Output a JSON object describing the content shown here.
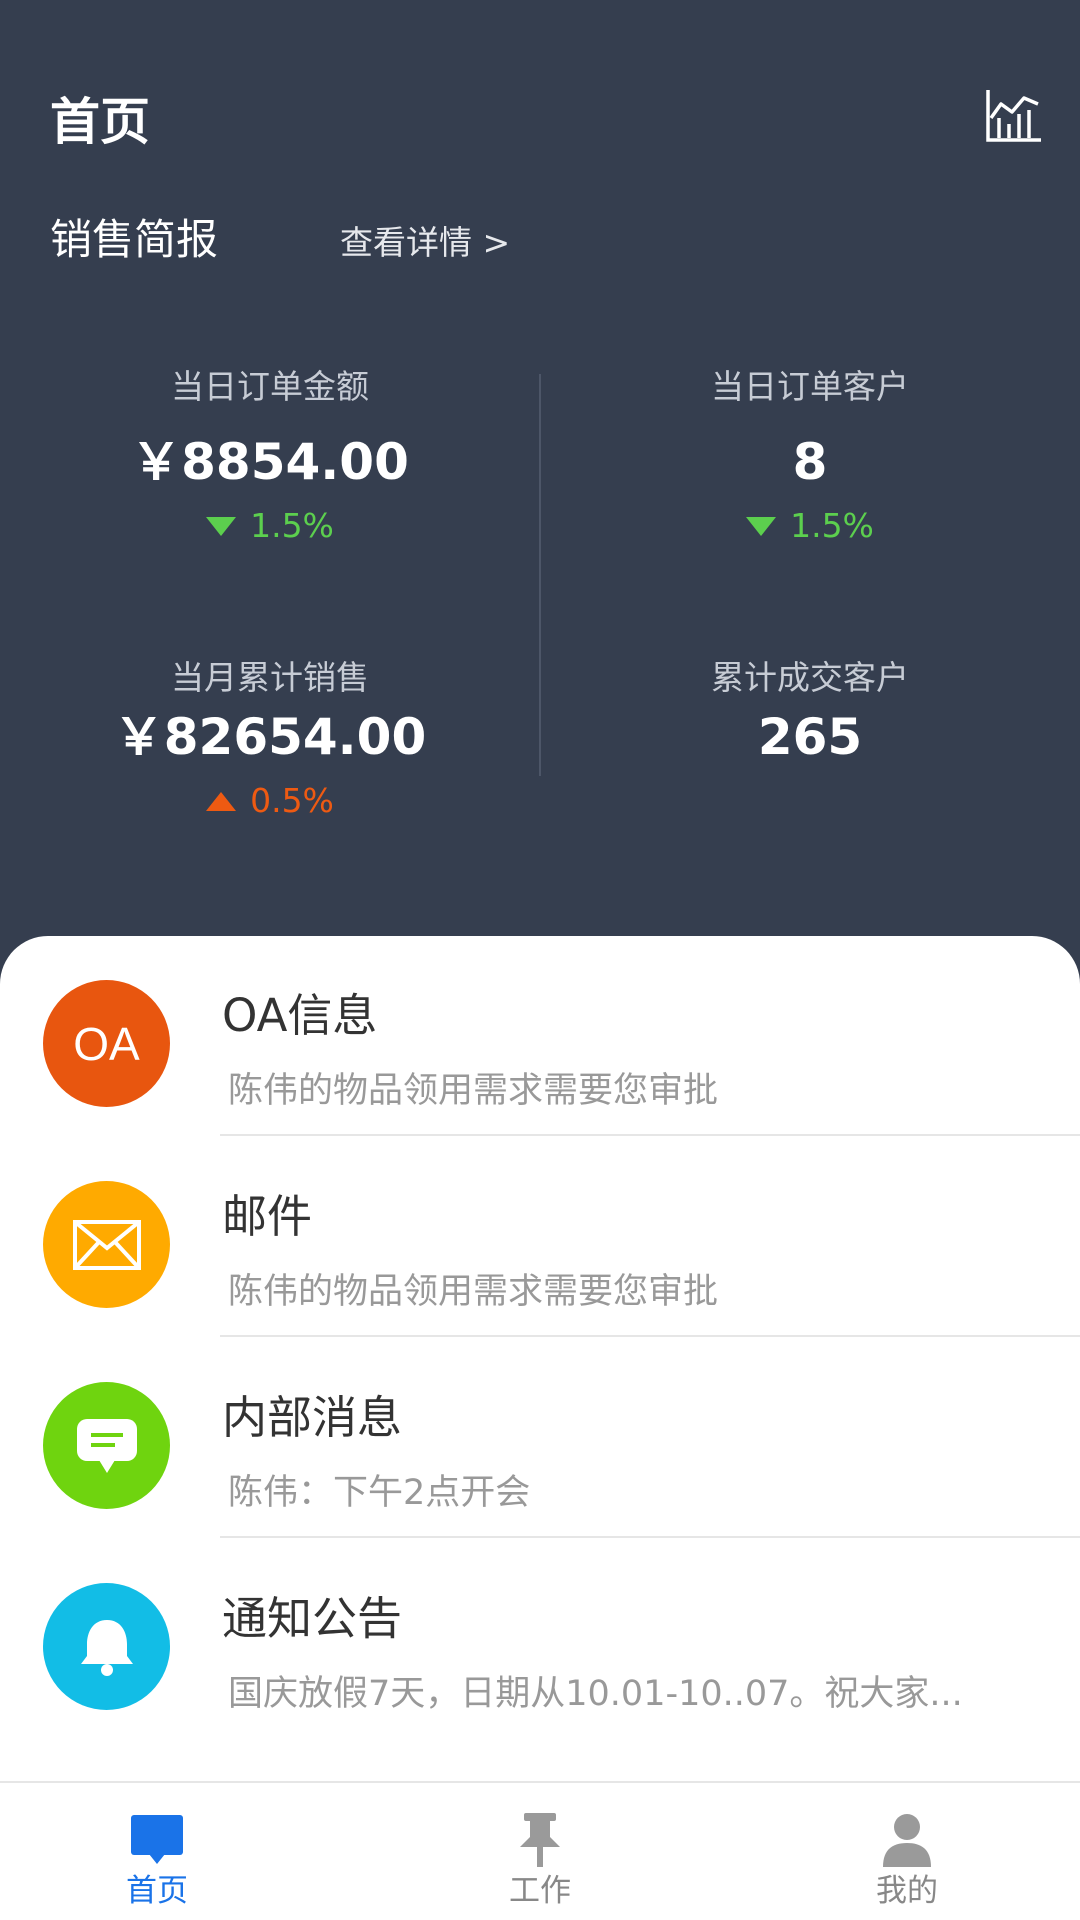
{
  "header": {
    "title": "首页",
    "chart_icon": "bar-chart-icon",
    "section_title": "销售简报",
    "details_link": "查看详情 >"
  },
  "stats": [
    {
      "label": "当日订单金额",
      "value": "￥8854.00",
      "trend": "1.5%",
      "direction": "down"
    },
    {
      "label": "当日订单客户",
      "value": "8",
      "trend": "1.5%",
      "direction": "down"
    },
    {
      "label": "当月累计销售",
      "value": "￥82654.00",
      "trend": "0.5%",
      "direction": "up"
    },
    {
      "label": "累计成交客户",
      "value": "265"
    }
  ],
  "messages": [
    {
      "title": "OA信息",
      "subtitle": "陈伟的物品领用需求需要您审批",
      "icon": "oa-icon",
      "icon_text": "OA",
      "color": "#e8560f"
    },
    {
      "title": "邮件",
      "subtitle": "陈伟的物品领用需求需要您审批",
      "icon": "mail-icon",
      "color": "#ffaa00"
    },
    {
      "title": "内部消息",
      "subtitle": "陈伟：下午2点开会",
      "icon": "chat-icon",
      "color": "#6fd40f"
    },
    {
      "title": "通知公告",
      "subtitle": "国庆放假7天，日期从10.01-10..07。祝大家...",
      "icon": "bell-icon",
      "color": "#12bde6"
    }
  ],
  "tabbar": {
    "items": [
      {
        "label": "首页",
        "icon": "home-chat-icon",
        "active": true
      },
      {
        "label": "工作",
        "icon": "pin-icon",
        "active": false
      },
      {
        "label": "我的",
        "icon": "user-icon",
        "active": false
      }
    ],
    "active_color": "#1a73e8",
    "inactive_color": "#888888"
  },
  "colors": {
    "header_bg": "#353e4f",
    "trend_down": "#5ccf4e",
    "trend_up": "#ee5a12"
  }
}
